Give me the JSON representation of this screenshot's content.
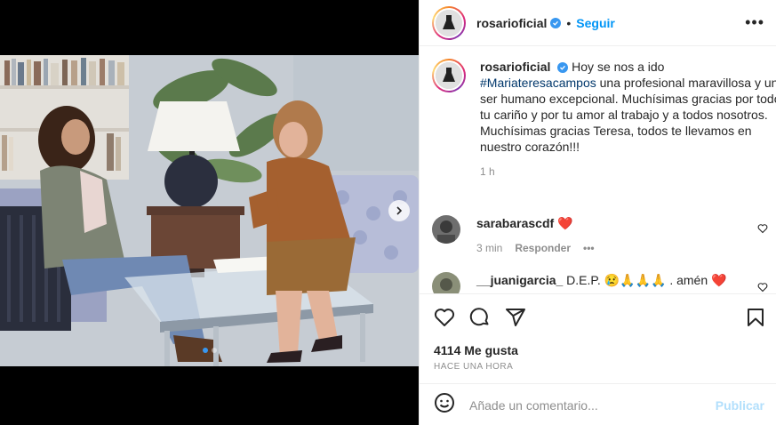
{
  "post": {
    "username": "rosarioficial",
    "follow_label": "Seguir",
    "separator": "•",
    "more_label": "•••"
  },
  "caption": {
    "username": "rosarioficial",
    "text_before": "Hoy se nos a ido",
    "hashtag": "#Mariateresacampos",
    "text_after": "una profesional maravillosa y un ser humano excepcional. Muchísimas gracias por todo tu cariño y por tu amor al trabajo y a todos nosotros. Muchísimas gracias Teresa, todos te llevamos en nuestro corazón!!!",
    "time": "1 h"
  },
  "comments": [
    {
      "username": "sarabarascdf",
      "text": "❤️",
      "time": "3 min",
      "reply_label": "Responder",
      "more_label": "•••"
    },
    {
      "username": "__juanigarcia_",
      "text": "D.E.P. 😢🙏🙏🙏 . amén ❤️"
    }
  ],
  "stats": {
    "likes": "4114 Me gusta",
    "posted": "HACE UNA HORA"
  },
  "comment_box": {
    "placeholder": "Añade un comentario...",
    "publish_label": "Publicar"
  },
  "colors": {
    "accent": "#0095f6",
    "verified": "#3897f0",
    "heart": "#d9534f"
  },
  "icons": [
    "verified-icon",
    "more-icon",
    "carousel-next-icon",
    "heart-icon",
    "comment-icon",
    "share-icon",
    "bookmark-icon",
    "emoji-icon"
  ]
}
